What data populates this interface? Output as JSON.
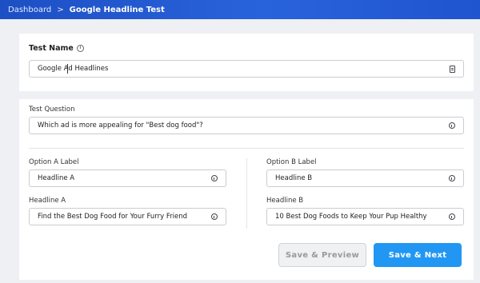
{
  "breadcrumb": {
    "parent": "Dashboard",
    "separator": ">",
    "current": "Google Headline Test"
  },
  "test_name": {
    "label": "Test Name",
    "value": "Google Ad Headlines"
  },
  "test_question": {
    "label": "Test Question",
    "value": "Which ad is more appealing for \"Best dog food\"?"
  },
  "option_a": {
    "label_title": "Option A Label",
    "label_value": "Headline A",
    "headline_title": "Headline A",
    "headline_value": "Find the Best Dog Food for Your Furry Friend"
  },
  "option_b": {
    "label_title": "Option B Label",
    "label_value": "Headline B",
    "headline_title": "Headline B",
    "headline_value": "10 Best Dog Foods to Keep Your Pup Healthy"
  },
  "buttons": {
    "preview": "Save & Preview",
    "next": "Save & Next"
  },
  "colors": {
    "topbar": "#2963db",
    "primary_button": "#2197f3",
    "background": "#eef0f4"
  }
}
